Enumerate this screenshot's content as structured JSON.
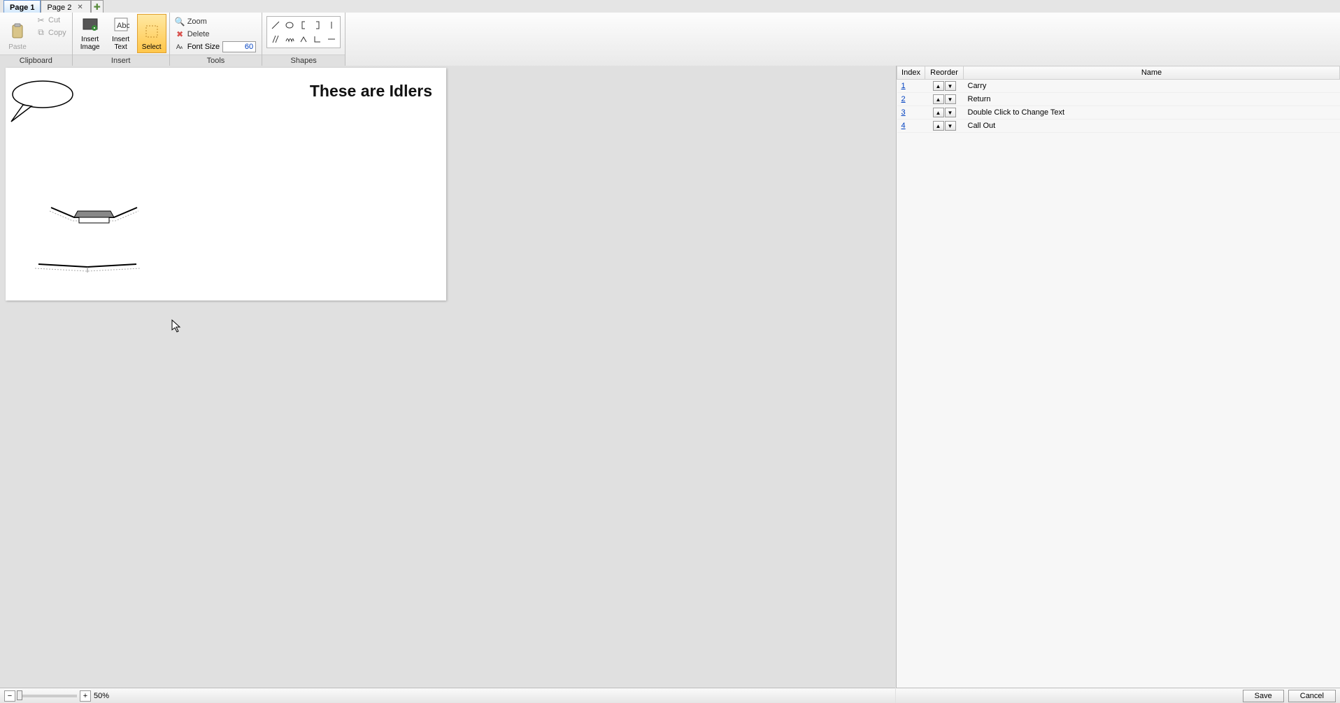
{
  "tabs": {
    "items": [
      {
        "label": "Page 1",
        "active": true,
        "closable": false
      },
      {
        "label": "Page 2",
        "active": false,
        "closable": true
      }
    ]
  },
  "ribbon": {
    "clipboard": {
      "title": "Clipboard",
      "paste": "Paste",
      "cut": "Cut",
      "copy": "Copy"
    },
    "insert": {
      "title": "Insert",
      "insert_image": "Insert\nImage",
      "insert_text": "Insert\nText",
      "select": "Select"
    },
    "tools": {
      "title": "Tools",
      "zoom": "Zoom",
      "delete": "Delete",
      "font_size_label": "Font Size",
      "font_size_value": "60"
    },
    "shapes": {
      "title": "Shapes",
      "items": [
        "line-diag",
        "ellipse",
        "bracket-left",
        "bracket-right",
        "vertical",
        "double-line",
        "wave",
        "caret",
        "angle",
        "dash"
      ]
    }
  },
  "canvas": {
    "title_text": "These are Idlers"
  },
  "sidepanel": {
    "headers": {
      "index": "Index",
      "reorder": "Reorder",
      "name": "Name"
    },
    "rows": [
      {
        "index": "1",
        "name": "Carry"
      },
      {
        "index": "2",
        "name": "Return"
      },
      {
        "index": "3",
        "name": "Double Click to Change Text"
      },
      {
        "index": "4",
        "name": "Call Out"
      }
    ]
  },
  "zoom": {
    "level": "50%"
  },
  "actions": {
    "save": "Save",
    "cancel": "Cancel"
  }
}
